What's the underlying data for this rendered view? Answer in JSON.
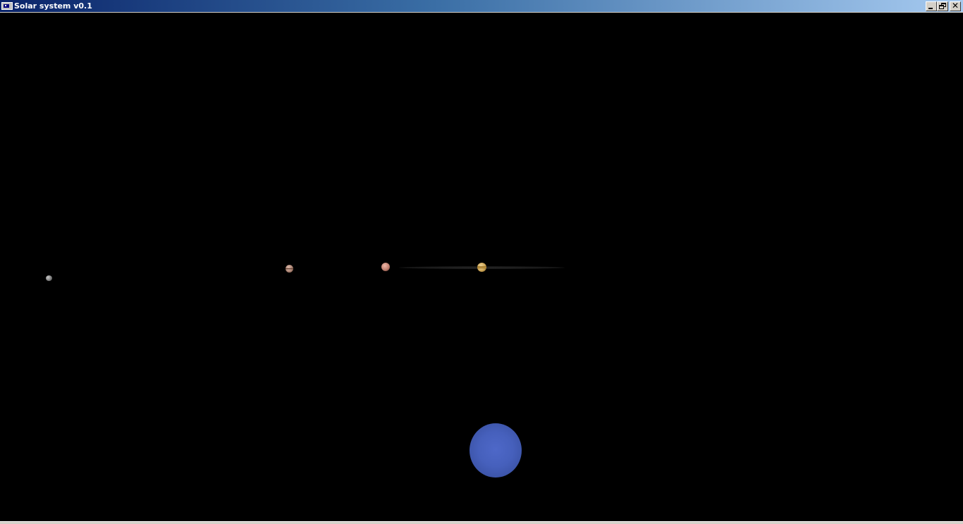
{
  "window": {
    "title": "Solar system v0.1",
    "controls": {
      "minimize": "minimize",
      "maximize": "restore",
      "close": "close",
      "close_glyph": "✕"
    }
  },
  "scene": {
    "bodies": [
      {
        "name": "grey-planet",
        "color": "#8c8c8c"
      },
      {
        "name": "banded-planet",
        "color": "#b08878"
      },
      {
        "name": "red-planet",
        "color": "#c88878"
      },
      {
        "name": "ringed-planet",
        "color": "#d6a848"
      },
      {
        "name": "blue-planet",
        "color": "#4660bc"
      }
    ]
  },
  "colors": {
    "titlebar_start": "#0a246a",
    "titlebar_end": "#a6caf0",
    "background": "#000000"
  }
}
